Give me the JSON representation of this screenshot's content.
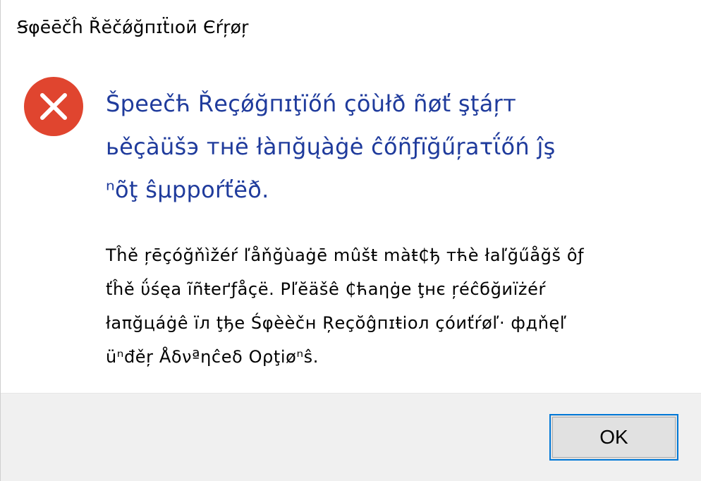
{
  "window": {
    "title": "Ꞩφēēčĥ Řĕčǿğпɪẗıоӣ Єŕŗøŗ"
  },
  "dialog": {
    "icon": "error-icon",
    "icon_color": "#e0452f",
    "main_instruction_lines": [
      "Šрееčћ Řеçǿğпɪţїőń çöùłð ñøť şţáŗт",
      "ьěçàüšэ тнë łàпğųàġė ĉőñƒïğűŗаτΐőń ĵş",
      "ⁿõţ ŝµрроŕťёð."
    ],
    "content_lines": [
      "Τĥě ŗēçóğňìžéŕ ľåňğùaġē mûšŧ màŧ₵ђ тћѐ łаľğűåğš ôƒ",
      "ťĥě ΰśęа ĩñŧеґƒåçë.  Ρľĕäšê ₵ћаηġе ţнє ŗéĉбğиïżéŕ",
      "łаπğцáġê ïл ţђе Śφèèčн Ŗеçŏĝпɪŧіол çόиťŕøľ· фдňęľ",
      "üⁿđěŗ Åδνªηĉеδ Оρţіøⁿŝ."
    ],
    "ok_label": "OK"
  },
  "colors": {
    "accent": "#0078d7",
    "instruction_text": "#1f3b9c",
    "footer_bg": "#f0f0f0"
  }
}
